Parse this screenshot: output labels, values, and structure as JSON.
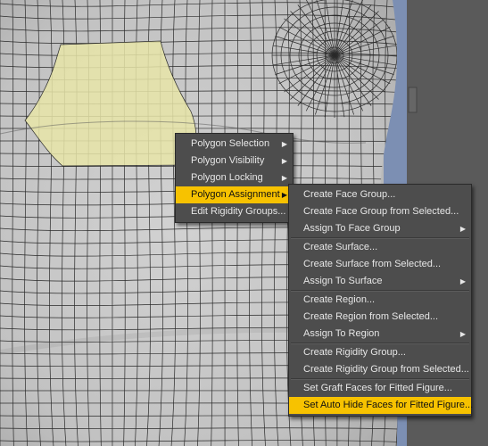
{
  "context_menu": {
    "items": [
      {
        "label": "Polygon Selection",
        "has_submenu": true,
        "highlighted": false
      },
      {
        "label": "Polygon Visibility",
        "has_submenu": true,
        "highlighted": false
      },
      {
        "label": "Polygon Locking",
        "has_submenu": true,
        "highlighted": false
      },
      {
        "label": "Polygon Assignment",
        "has_submenu": true,
        "highlighted": true
      },
      {
        "label": "Edit Rigidity Groups...",
        "has_submenu": false,
        "highlighted": false
      }
    ]
  },
  "submenu": {
    "groups": [
      [
        {
          "label": "Create Face Group..."
        },
        {
          "label": "Create Face Group from Selected..."
        },
        {
          "label": "Assign To Face Group",
          "has_submenu": true
        }
      ],
      [
        {
          "label": "Create Surface..."
        },
        {
          "label": "Create Surface from Selected..."
        },
        {
          "label": "Assign To Surface",
          "has_submenu": true
        }
      ],
      [
        {
          "label": "Create Region..."
        },
        {
          "label": "Create Region from Selected..."
        },
        {
          "label": "Assign To Region",
          "has_submenu": true
        }
      ],
      [
        {
          "label": "Create Rigidity Group..."
        },
        {
          "label": "Create Rigidity Group from Selected..."
        }
      ],
      [
        {
          "label": "Set Graft Faces for Fitted Figure..."
        },
        {
          "label": "Set Auto Hide Faces for Fitted Figure...",
          "highlighted": true
        }
      ]
    ]
  },
  "colors": {
    "menu_bg": "#4d4d4d",
    "highlight": "#f7c200",
    "mesh": "#c4c4c4",
    "selection": "#e6e3a6",
    "side_panel": "#6a7fa8"
  },
  "icons": {
    "submenu_arrow": "triangle-right"
  }
}
